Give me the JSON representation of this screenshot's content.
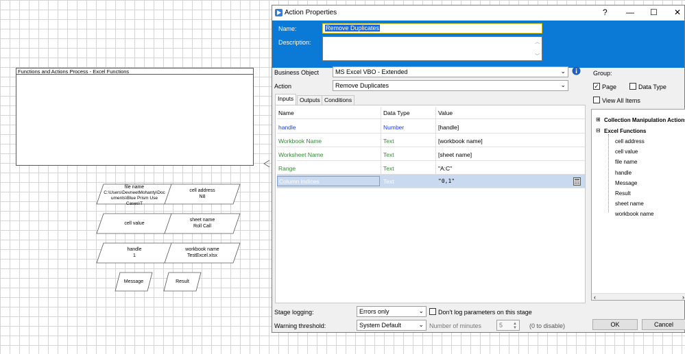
{
  "canvas": {
    "stage_title": "Functions and Actions Process - Excel Functions",
    "data_items": [
      {
        "name": "file name",
        "value": "C:\\Users\\DevneetMohanty\\Doc uments\\Blue Prism Use Cases\\T"
      },
      {
        "name": "cell address",
        "value": "N8"
      },
      {
        "name": "cell value",
        "value": ""
      },
      {
        "name": "sheet name",
        "value": "Roll Call"
      },
      {
        "name": "handle",
        "value": "1"
      },
      {
        "name": "workbook name",
        "value": "TestExcel.xlsx"
      },
      {
        "name": "Message",
        "value": ""
      },
      {
        "name": "Result",
        "value": ""
      }
    ]
  },
  "dialog": {
    "title": "Action Properties",
    "help": "?",
    "minimize": "—",
    "maximize": "☐",
    "close": "✕",
    "name_label": "Name:",
    "name_value": "Remove Duplicates",
    "description_label": "Description:",
    "description_value": "",
    "business_object_label": "Business Object",
    "business_object_value": "MS Excel VBO - Extended",
    "action_label": "Action",
    "action_value": "Remove Duplicates",
    "tabs": [
      "Inputs",
      "Outputs",
      "Conditions"
    ],
    "grid": {
      "headers": [
        "Name",
        "Data Type",
        "Value"
      ],
      "rows": [
        {
          "name": "handle",
          "type": "Number",
          "value": "[handle]"
        },
        {
          "name": "Workbook Name",
          "type": "Text",
          "value": "[workbook name]"
        },
        {
          "name": "Worksheet Name",
          "type": "Text",
          "value": "[sheet name]"
        },
        {
          "name": "Range",
          "type": "Text",
          "value": "\"A:C\""
        },
        {
          "name": "Column Indices",
          "type": "Text",
          "value": "\"0,1\""
        }
      ]
    },
    "group_label": "Group:",
    "page_label": "Page",
    "datatype_label": "Data Type",
    "viewall_label": "View All Items",
    "tree": {
      "collection": "Collection Manipulation Actions",
      "excel": "Excel Functions",
      "children": [
        "cell address",
        "cell value",
        "file name",
        "handle",
        "Message",
        "Result",
        "sheet name",
        "workbook name"
      ]
    },
    "stage_logging_label": "Stage logging:",
    "stage_logging_value": "Errors only",
    "dont_log_label": "Don't log parameters on this stage",
    "warning_label": "Warning threshold:",
    "warning_value": "System Default",
    "minutes_label": "Number of minutes",
    "minutes_value": "5",
    "disable_hint": "(0 to disable)",
    "ok_label": "OK",
    "cancel_label": "Cancel"
  },
  "colors": {
    "band": "#0b79d6",
    "blue_text": "#1d40d8",
    "green_text": "#2e8b2e",
    "selected_row": "#c9d9ef"
  }
}
